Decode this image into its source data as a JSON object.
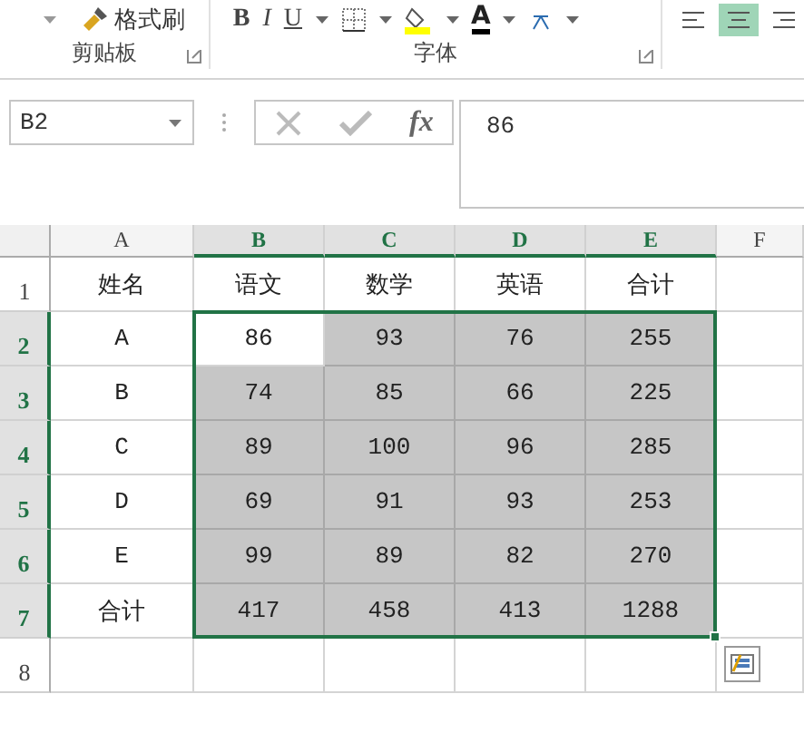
{
  "ribbon": {
    "clipboard": {
      "format_painter": "格式刷",
      "label": "剪贴板"
    },
    "font": {
      "bold": "B",
      "italic": "I",
      "underline": "U",
      "font_color": "A",
      "label": "字体"
    },
    "alignment": [
      {
        "selected": false
      },
      {
        "selected": true
      },
      {
        "selected": false
      }
    ]
  },
  "formula_bar": {
    "name_box": "B2",
    "function_label": "fx",
    "value": "86"
  },
  "sheet": {
    "columns": [
      {
        "label": "A",
        "selected": false
      },
      {
        "label": "B",
        "selected": true
      },
      {
        "label": "C",
        "selected": true
      },
      {
        "label": "D",
        "selected": true
      },
      {
        "label": "E",
        "selected": true
      },
      {
        "label": "F",
        "selected": false
      }
    ],
    "rows": [
      {
        "label": "1",
        "selected": false,
        "cells": [
          {
            "text": "姓名",
            "selected": false
          },
          {
            "text": "语文",
            "selected": false
          },
          {
            "text": "数学",
            "selected": false
          },
          {
            "text": "英语",
            "selected": false
          },
          {
            "text": "合计",
            "selected": false
          }
        ]
      },
      {
        "label": "2",
        "selected": true,
        "cells": [
          {
            "text": "A",
            "selected": false
          },
          {
            "text": "86",
            "selected": false
          },
          {
            "text": "93",
            "selected": true
          },
          {
            "text": "76",
            "selected": true
          },
          {
            "text": "255",
            "selected": true
          }
        ]
      },
      {
        "label": "3",
        "selected": true,
        "cells": [
          {
            "text": "B",
            "selected": false
          },
          {
            "text": "74",
            "selected": true
          },
          {
            "text": "85",
            "selected": true
          },
          {
            "text": "66",
            "selected": true
          },
          {
            "text": "225",
            "selected": true
          }
        ]
      },
      {
        "label": "4",
        "selected": true,
        "cells": [
          {
            "text": "C",
            "selected": false
          },
          {
            "text": "89",
            "selected": true
          },
          {
            "text": "100",
            "selected": true
          },
          {
            "text": "96",
            "selected": true
          },
          {
            "text": "285",
            "selected": true
          }
        ]
      },
      {
        "label": "5",
        "selected": true,
        "cells": [
          {
            "text": "D",
            "selected": false
          },
          {
            "text": "69",
            "selected": true
          },
          {
            "text": "91",
            "selected": true
          },
          {
            "text": "93",
            "selected": true
          },
          {
            "text": "253",
            "selected": true
          }
        ]
      },
      {
        "label": "6",
        "selected": true,
        "cells": [
          {
            "text": "E",
            "selected": false
          },
          {
            "text": "99",
            "selected": true
          },
          {
            "text": "89",
            "selected": true
          },
          {
            "text": "82",
            "selected": true
          },
          {
            "text": "270",
            "selected": true
          }
        ]
      },
      {
        "label": "7",
        "selected": true,
        "cells": [
          {
            "text": "合计",
            "selected": false
          },
          {
            "text": "417",
            "selected": true
          },
          {
            "text": "458",
            "selected": true
          },
          {
            "text": "413",
            "selected": true
          },
          {
            "text": "1288",
            "selected": true
          }
        ]
      },
      {
        "label": "8",
        "selected": false
      }
    ]
  }
}
